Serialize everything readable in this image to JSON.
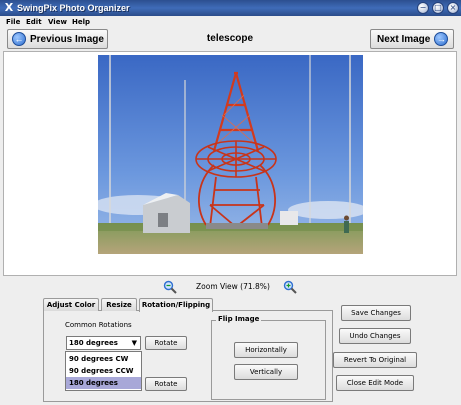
{
  "window": {
    "app_icon": "X",
    "title": "SwingPix Photo Organizer",
    "buttons": [
      "minimize-icon",
      "maximize-icon",
      "close-icon"
    ]
  },
  "menu": [
    "File",
    "Edit",
    "View",
    "Help"
  ],
  "nav": {
    "previous_label": "Previous Image",
    "next_label": "Next Image",
    "image_title": "telescope",
    "arrow_left": "←",
    "arrow_right": "→"
  },
  "zoom": {
    "label": "Zoom View (71.8%)",
    "zoom_out_icon": "zoom-out-icon",
    "zoom_in_icon": "zoom-in-icon"
  },
  "edit": {
    "tabs": [
      "Adjust Color",
      "Resize",
      "Rotation/Flipping"
    ],
    "active_tab": "Rotation/Flipping",
    "common_rotations_label": "Common Rotations",
    "selected_rotation": "180 degrees",
    "rotation_options": [
      "90 degrees CW",
      "90 degrees CCW",
      "180 degrees"
    ],
    "rotate_label": "Rotate",
    "flip_legend": "Flip Image",
    "flip_horizontal": "Horizontally",
    "flip_vertical": "Vertically"
  },
  "actions": {
    "save": "Save Changes",
    "undo": "Undo Changes",
    "revert": "Revert To Original",
    "close": "Close Edit Mode"
  },
  "colors": {
    "title_bar": "#3f6cb8",
    "selection": "#a8a8d8"
  }
}
